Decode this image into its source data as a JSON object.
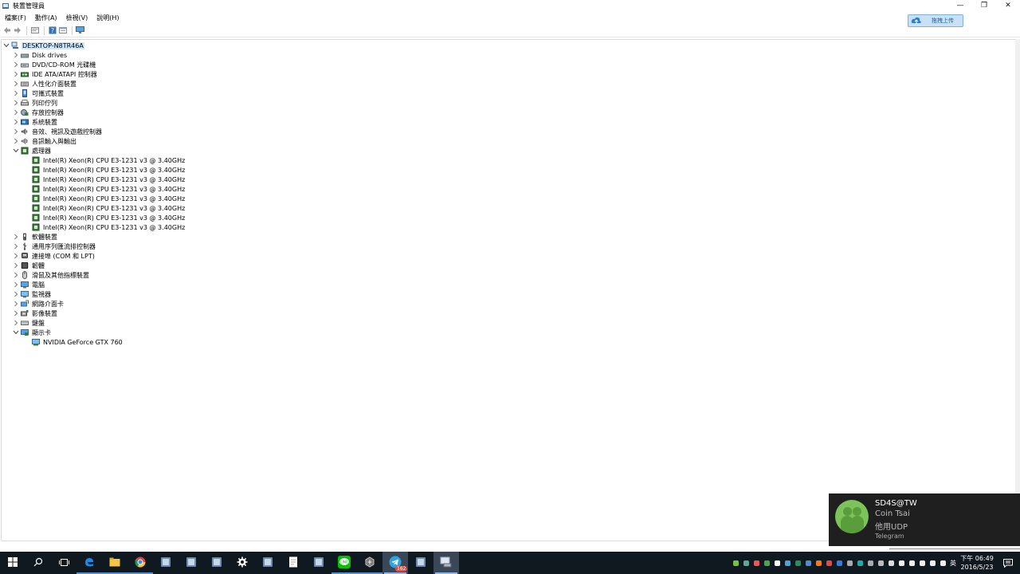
{
  "window": {
    "title": "裝置管理員",
    "minimize": "—",
    "maximize": "❐",
    "close": "✕"
  },
  "menu": [
    "檔案(F)",
    "動作(A)",
    "檢視(V)",
    "說明(H)"
  ],
  "upload_badge": {
    "label": "拖拽上传"
  },
  "tree": {
    "root": "DESKTOP-N8TR46A",
    "categories": [
      {
        "label": "Disk drives",
        "expanded": false,
        "icon": "disk-drive-icon"
      },
      {
        "label": "DVD/CD-ROM 光碟機",
        "expanded": false,
        "icon": "dvd-drive-icon"
      },
      {
        "label": "IDE ATA/ATAPI 控制器",
        "expanded": false,
        "icon": "ide-controller-icon"
      },
      {
        "label": "人性化介面裝置",
        "expanded": false,
        "icon": "hid-icon"
      },
      {
        "label": "可攜式裝置",
        "expanded": false,
        "icon": "portable-device-icon"
      },
      {
        "label": "列印佇列",
        "expanded": false,
        "icon": "printer-icon"
      },
      {
        "label": "存放控制器",
        "expanded": false,
        "icon": "storage-controller-icon"
      },
      {
        "label": "系統裝置",
        "expanded": false,
        "icon": "system-device-icon"
      },
      {
        "label": "音效、視訊及遊戲控制器",
        "expanded": false,
        "icon": "speaker-icon"
      },
      {
        "label": "音訊輸入與輸出",
        "expanded": false,
        "icon": "audio-io-icon"
      },
      {
        "label": "處理器",
        "expanded": true,
        "icon": "processor-icon"
      },
      {
        "label": "軟體裝置",
        "expanded": false,
        "icon": "software-device-icon"
      },
      {
        "label": "通用序列匯流排控制器",
        "expanded": false,
        "icon": "usb-icon"
      },
      {
        "label": "連接埠 (COM 和 LPT)",
        "expanded": false,
        "icon": "port-icon"
      },
      {
        "label": "韌體",
        "expanded": false,
        "icon": "firmware-icon"
      },
      {
        "label": "滑鼠及其他指標裝置",
        "expanded": false,
        "icon": "mouse-icon"
      },
      {
        "label": "電腦",
        "expanded": false,
        "icon": "computer-icon"
      },
      {
        "label": "監視器",
        "expanded": false,
        "icon": "monitor-icon"
      },
      {
        "label": "網路介面卡",
        "expanded": false,
        "icon": "network-adapter-icon"
      },
      {
        "label": "影像裝置",
        "expanded": false,
        "icon": "imaging-device-icon"
      },
      {
        "label": "鍵盤",
        "expanded": false,
        "icon": "keyboard-icon"
      },
      {
        "label": "顯示卡",
        "expanded": true,
        "icon": "display-adapter-icon"
      }
    ],
    "processors": [
      "Intel(R) Xeon(R) CPU E3-1231 v3 @ 3.40GHz",
      "Intel(R) Xeon(R) CPU E3-1231 v3 @ 3.40GHz",
      "Intel(R) Xeon(R) CPU E3-1231 v3 @ 3.40GHz",
      "Intel(R) Xeon(R) CPU E3-1231 v3 @ 3.40GHz",
      "Intel(R) Xeon(R) CPU E3-1231 v3 @ 3.40GHz",
      "Intel(R) Xeon(R) CPU E3-1231 v3 @ 3.40GHz",
      "Intel(R) Xeon(R) CPU E3-1231 v3 @ 3.40GHz",
      "Intel(R) Xeon(R) CPU E3-1231 v3 @ 3.40GHz"
    ],
    "display_adapters": [
      "NVIDIA GeForce GTX 760"
    ]
  },
  "notification": {
    "title": "SD4S@TW",
    "sender": "Coin Tsai",
    "message": "他用UDP",
    "app": "Telegram"
  },
  "taskbar": {
    "apps": [
      "windows-start-icon",
      "search-icon",
      "task-view-icon",
      "edge-icon",
      "file-explorer-icon",
      "chrome-icon",
      "app-icon",
      "app-icon",
      "app-icon",
      "settings-icon",
      "app-icon",
      "notepad-icon",
      "app-icon",
      "line-icon",
      "game-icon",
      "telegram-icon",
      "app-icon",
      "device-manager-icon"
    ],
    "telegram_badge": "162",
    "ime": "英",
    "clock_time": "下午 06:49",
    "clock_date": "2016/5/23"
  },
  "colors": {
    "selection": "#cce8ff",
    "taskbar": "#101820",
    "toast_bg": "#1f1f1f"
  }
}
